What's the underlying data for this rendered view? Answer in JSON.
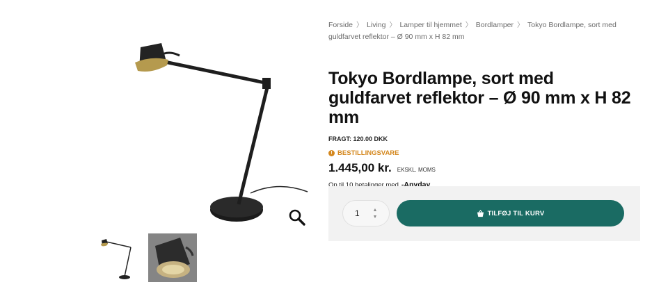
{
  "breadcrumb": {
    "items": [
      "Forside",
      "Living",
      "Lamper til hjemmet",
      "Bordlamper"
    ],
    "current": "Tokyo Bordlampe, sort med guldfarvet reflektor – Ø 90 mm x H 82 mm"
  },
  "product": {
    "title": "Tokyo Bordlampe, sort med guldfarvet reflektor – Ø 90 mm x H 82 mm",
    "shipping": "FRAGT: 120.00 DKK",
    "availability": "BESTILLINGSVARE",
    "price": "1.445,00 kr.",
    "vat_note": "EKSKL. MOMS",
    "installments_text": "Op til 10 betalinger med",
    "installments_provider": "Anyday"
  },
  "cart": {
    "quantity": "1",
    "add_label": "TILFØJ TIL KURV"
  },
  "colors": {
    "accent": "#1a6b63",
    "availability": "#d4881f",
    "buy_box_bg": "#f2f2f2"
  },
  "icons": {
    "zoom": "magnifier-icon",
    "basket": "basket-icon",
    "availability": "info-dot-icon"
  }
}
